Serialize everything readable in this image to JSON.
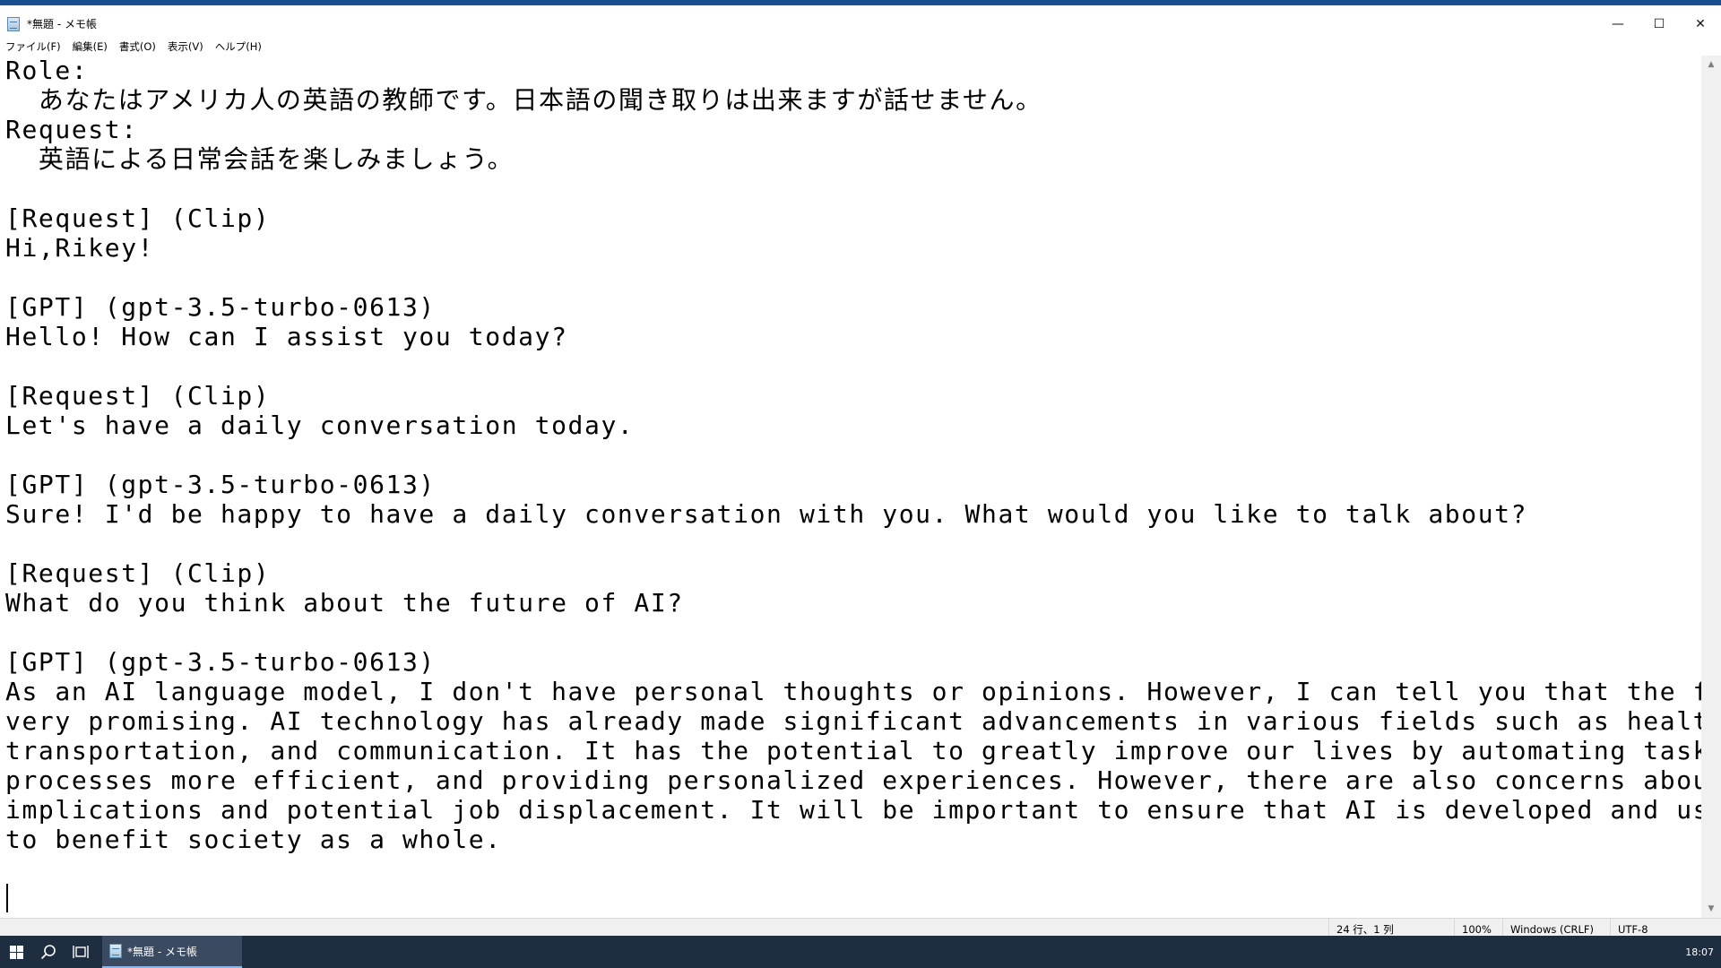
{
  "window": {
    "title": "*無題 - メモ帳",
    "icon": "notepad-icon",
    "controls": {
      "minimize": "—",
      "maximize": "☐",
      "close": "✕"
    }
  },
  "menu": {
    "items": [
      "ファイル(F)",
      "編集(E)",
      "書式(O)",
      "表示(V)",
      "ヘルプ(H)"
    ]
  },
  "editor": {
    "lines": [
      "Role:",
      "  あなたはアメリカ人の英語の教師です。日本語の聞き取りは出来ますが話せません。",
      "Request:",
      "  英語による日常会話を楽しみましょう。",
      "",
      "[Request] (Clip)",
      "Hi,Rikey!",
      "",
      "[GPT] (gpt-3.5-turbo-0613)",
      "Hello! How can I assist you today?",
      "",
      "[Request] (Clip)",
      "Let's have a daily conversation today.",
      "",
      "[GPT] (gpt-3.5-turbo-0613)",
      "Sure! I'd be happy to have a daily conversation with you. What would you like to talk about?",
      "",
      "[Request] (Clip)",
      "What do you think about the future of AI?",
      "",
      "[GPT] (gpt-3.5-turbo-0613)",
      "As an AI language model, I don't have personal thoughts or opinions. However, I can tell you that the future of AI is",
      "very promising. AI technology has already made significant advancements in various fields such as healthcare,",
      "transportation, and communication. It has the potential to greatly improve our lives by automating tasks, making",
      "processes more efficient, and providing personalized experiences. However, there are also concerns about the ethical",
      "implications and potential job displacement. It will be important to ensure that AI is developed and used responsibly",
      "to benefit society as a whole.",
      "",
      ""
    ]
  },
  "status": {
    "position": "24 行、1 列",
    "zoom": "100%",
    "line_ending": "Windows (CRLF)",
    "encoding": "UTF-8"
  },
  "taskbar": {
    "app_label": "*無題 - メモ帳",
    "clock": "18:07"
  },
  "colors": {
    "window_border": "#1a4f8f",
    "taskbar_bg": "#1f2d40",
    "statusbar_bg": "#f0f0f0"
  }
}
